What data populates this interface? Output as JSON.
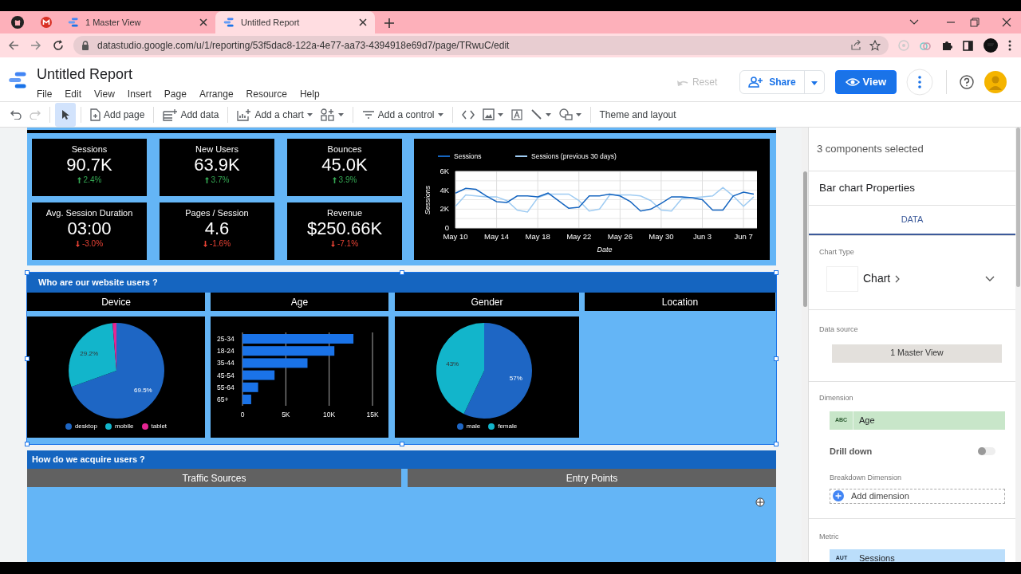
{
  "browser": {
    "tabs": [
      {
        "title": "1 Master View",
        "selected": false
      },
      {
        "title": "Untitled Report",
        "selected": true
      }
    ],
    "url": "datastudio.google.com/u/1/reporting/53f5dac8-122a-4e77-aa73-4394918e69d7/page/TRwuC/edit"
  },
  "app": {
    "title": "Untitled Report",
    "menu": [
      "File",
      "Edit",
      "View",
      "Insert",
      "Page",
      "Arrange",
      "Resource",
      "Help"
    ],
    "reset": {
      "label": "Reset",
      "disabled": true
    },
    "share": "Share",
    "view": "View"
  },
  "toolbar": {
    "pointer_selected": true,
    "redo_disabled": true,
    "add_page": "Add page",
    "add_data": "Add data",
    "add_chart": "Add a chart",
    "add_control": "Add a control",
    "theme": "Theme and layout"
  },
  "scorecards": [
    {
      "label": "Sessions",
      "value": "90.7K",
      "change": "2.4%",
      "positive": true
    },
    {
      "label": "New Users",
      "value": "63.9K",
      "change": "3.7%",
      "positive": true
    },
    {
      "label": "Bounces",
      "value": "45.0K",
      "change": "3.9%",
      "positive": true
    },
    {
      "label": "Avg. Session Duration",
      "value": "03:00",
      "change": "-3.0%",
      "positive": false
    },
    {
      "label": "Pages / Session",
      "value": "4.6",
      "change": "-1.6%",
      "positive": false
    },
    {
      "label": "Revenue",
      "value": "$250.66K",
      "change": "-7.1%",
      "positive": false
    }
  ],
  "trend_chart": {
    "chart_data": {
      "type": "line",
      "xlabel": "Date",
      "ylabel": "Sessions",
      "categories": [
        "May 10",
        null,
        null,
        null,
        "May 14",
        null,
        null,
        null,
        "May 18",
        null,
        null,
        null,
        "May 22",
        null,
        null,
        null,
        "May 26",
        null,
        null,
        null,
        "May 30",
        null,
        null,
        null,
        "Jun 3",
        null,
        null,
        null,
        "Jun 7",
        null
      ],
      "series": [
        {
          "name": "Sessions",
          "color": "#1565c0",
          "values": [
            3700,
            4200,
            4100,
            3400,
            2800,
            2700,
            3400,
            3400,
            3300,
            3700,
            2900,
            2100,
            2200,
            3400,
            3400,
            3600,
            3400,
            2800,
            1800,
            2000,
            2600,
            3300,
            3300,
            3200,
            3000,
            1900,
            1900,
            3400,
            3800,
            3600
          ]
        },
        {
          "name": "Sessions (previous 30 days)",
          "color": "#9ecbf2",
          "values": [
            2300,
            3500,
            3400,
            3300,
            3300,
            2900,
            1900,
            1700,
            3200,
            3600,
            3600,
            3600,
            2900,
            1800,
            2000,
            3500,
            3500,
            3500,
            3400,
            2900,
            1900,
            1800,
            3100,
            3200,
            3300,
            3400,
            4300,
            3400,
            2300,
            3300
          ]
        }
      ],
      "grid": true,
      "legend": "top",
      "ylim": [
        0,
        6000
      ],
      "yticks": [
        {
          "value": 0,
          "label": "0"
        },
        {
          "value": 2000,
          "label": "2K"
        },
        {
          "value": 4000,
          "label": "4K"
        },
        {
          "value": 6000,
          "label": "6K"
        }
      ]
    }
  },
  "sections": [
    {
      "title": "Who are our website users ?",
      "selected": true,
      "panels": [
        {
          "title": "Device",
          "chart_data": {
            "type": "pie",
            "categories": [
              "desktop",
              "mobile",
              "tablet"
            ],
            "values": [
              69.5,
              29.2,
              1.3
            ],
            "colors": [
              "#1e66c4",
              "#12b5cb",
              "#e52592"
            ],
            "legend": "bottom",
            "value_labels": [
              "69.5%",
              "29.2%",
              null
            ]
          }
        },
        {
          "title": "Age",
          "chart_data": {
            "type": "bar",
            "orientation": "horizontal",
            "categories": [
              "25-34",
              "18-24",
              "35-44",
              "45-54",
              "55-64",
              "65+"
            ],
            "series": [
              {
                "color": "#1a73e8",
                "values": [
                  12800,
                  10600,
                  7500,
                  3700,
                  1800,
                  1000
                ]
              }
            ],
            "xlim": [
              0,
              15000
            ],
            "xticks": [
              {
                "value": 0,
                "label": "0"
              },
              {
                "value": 5000,
                "label": "5K"
              },
              {
                "value": 10000,
                "label": "10K"
              },
              {
                "value": 15000,
                "label": "15K"
              }
            ]
          }
        },
        {
          "title": "Gender",
          "chart_data": {
            "type": "pie",
            "categories": [
              "male",
              "female"
            ],
            "values": [
              57,
              43
            ],
            "colors": [
              "#1e66c4",
              "#12b5cb"
            ],
            "legend": "bottom",
            "value_labels": [
              "57%",
              "43%"
            ]
          }
        },
        {
          "title": "Location"
        }
      ]
    },
    {
      "title": "How do we acquire users ?",
      "selected": false,
      "panels": [
        {
          "title": "Traffic Sources"
        },
        {
          "title": "Entry Points"
        }
      ]
    }
  ],
  "properties": {
    "selection": "3 components selected",
    "title": "Bar chart Properties",
    "tabs": [
      {
        "label": "DATA",
        "selected": true
      }
    ],
    "chart_type_label": "Chart Type",
    "chart_type": "Chart",
    "data_source_label": "Data source",
    "data_source": "1 Master View",
    "dimension_label": "Dimension",
    "dimension": {
      "type": "ABC",
      "name": "Age"
    },
    "drill_down": {
      "label": "Drill down",
      "on": false
    },
    "breakdown_label": "Breakdown Dimension",
    "add_dimension": "Add dimension",
    "metric_label": "Metric",
    "metric": {
      "type": "AUT",
      "name": "Sessions"
    }
  }
}
